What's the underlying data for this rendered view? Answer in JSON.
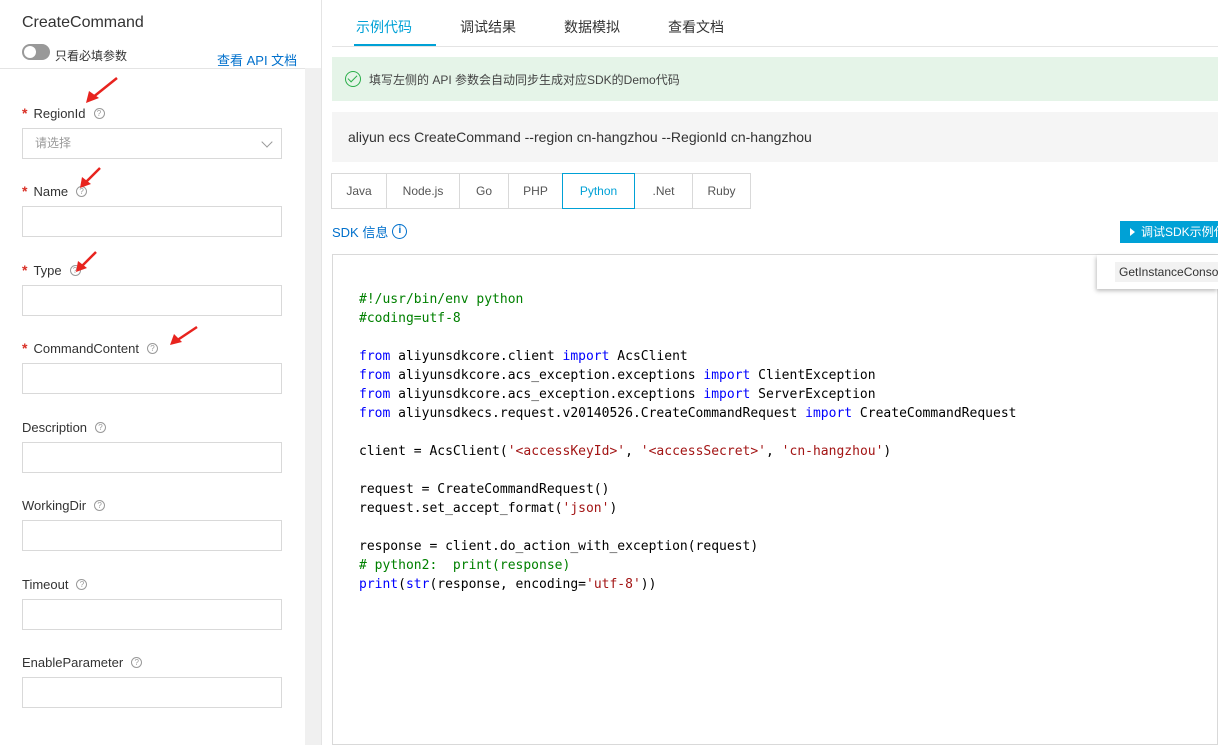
{
  "left": {
    "api_name": "CreateCommand",
    "toggle_label": "只看必填参数",
    "api_doc_link": "查看 API 文档",
    "fields": [
      {
        "label": "RegionId",
        "required": true,
        "type": "select",
        "placeholder": "请选择"
      },
      {
        "label": "Name",
        "required": true,
        "type": "text",
        "value": ""
      },
      {
        "label": "Type",
        "required": true,
        "type": "text",
        "value": ""
      },
      {
        "label": "CommandContent",
        "required": true,
        "type": "text",
        "value": ""
      },
      {
        "label": "Description",
        "required": false,
        "type": "text",
        "value": ""
      },
      {
        "label": "WorkingDir",
        "required": false,
        "type": "text",
        "value": ""
      },
      {
        "label": "Timeout",
        "required": false,
        "type": "text",
        "value": ""
      },
      {
        "label": "EnableParameter",
        "required": false,
        "type": "text",
        "value": ""
      }
    ],
    "required_mark": "*",
    "help_glyph": "?"
  },
  "tabs": [
    {
      "label": "示例代码",
      "active": true
    },
    {
      "label": "调试结果",
      "active": false
    },
    {
      "label": "数据模拟",
      "active": false
    },
    {
      "label": "查看文档",
      "active": false
    }
  ],
  "notice": {
    "text": "填写左侧的 API 参数会自动同步生成对应SDK的Demo代码"
  },
  "cli_command": "aliyun ecs CreateCommand --region cn-hangzhou --RegionId cn-hangzhou",
  "languages": [
    {
      "label": "Java",
      "active": false
    },
    {
      "label": "Node.js",
      "active": false
    },
    {
      "label": "Go",
      "active": false
    },
    {
      "label": "PHP",
      "active": false
    },
    {
      "label": "Python",
      "active": true
    },
    {
      ".label": ".Net",
      "label": ".Net",
      "active": false
    },
    {
      "label": "Ruby",
      "active": false
    }
  ],
  "sdk_info": {
    "label": "SDK 信息",
    "icon": "info-icon"
  },
  "debug_button": {
    "label": "调试SDK示例代码"
  },
  "code_dropdown": {
    "item": "GetInstanceConsoleOutput"
  },
  "colors": {
    "accent": "#00a1d6",
    "link": "#0070cc",
    "required": "#d93026",
    "notice_bg": "#e5f4e8",
    "annotation_arrow": "#e8231e"
  },
  "code_lines": [
    [
      {
        "t": "#!/usr/bin/env python",
        "c": "comment"
      }
    ],
    [
      {
        "t": "#coding=utf-8",
        "c": "comment"
      }
    ],
    [],
    [
      {
        "t": "from",
        "c": "kw"
      },
      {
        "t": " aliyunsdkcore.client ",
        "c": "norm"
      },
      {
        "t": "import",
        "c": "kw"
      },
      {
        "t": " AcsClient",
        "c": "norm"
      }
    ],
    [
      {
        "t": "from",
        "c": "kw"
      },
      {
        "t": " aliyunsdkcore.acs_exception.exceptions ",
        "c": "norm"
      },
      {
        "t": "import",
        "c": "kw"
      },
      {
        "t": " ClientException",
        "c": "norm"
      }
    ],
    [
      {
        "t": "from",
        "c": "kw"
      },
      {
        "t": " aliyunsdkcore.acs_exception.exceptions ",
        "c": "norm"
      },
      {
        "t": "import",
        "c": "kw"
      },
      {
        "t": " ServerException",
        "c": "norm"
      }
    ],
    [
      {
        "t": "from",
        "c": "kw"
      },
      {
        "t": " aliyunsdkecs.request.v20140526.CreateCommandRequest ",
        "c": "norm"
      },
      {
        "t": "import",
        "c": "kw"
      },
      {
        "t": " CreateCommandRequest",
        "c": "norm"
      }
    ],
    [],
    [
      {
        "t": "client = AcsClient(",
        "c": "norm"
      },
      {
        "t": "'<accessKeyId>'",
        "c": "str"
      },
      {
        "t": ", ",
        "c": "norm"
      },
      {
        "t": "'<accessSecret>'",
        "c": "str"
      },
      {
        "t": ", ",
        "c": "norm"
      },
      {
        "t": "'cn-hangzhou'",
        "c": "str"
      },
      {
        "t": ")",
        "c": "norm"
      }
    ],
    [],
    [
      {
        "t": "request = CreateCommandRequest()",
        "c": "norm"
      }
    ],
    [
      {
        "t": "request.set_accept_format(",
        "c": "norm"
      },
      {
        "t": "'json'",
        "c": "str"
      },
      {
        "t": ")",
        "c": "norm"
      }
    ],
    [],
    [
      {
        "t": "response = client.do_action_with_exception(request)",
        "c": "norm"
      }
    ],
    [
      {
        "t": "# python2:  print(response)",
        "c": "comment"
      }
    ],
    [
      {
        "t": "print",
        "c": "kw"
      },
      {
        "t": "(",
        "c": "norm"
      },
      {
        "t": "str",
        "c": "kw"
      },
      {
        "t": "(response, encoding=",
        "c": "norm"
      },
      {
        "t": "'utf-8'",
        "c": "str"
      },
      {
        "t": "))",
        "c": "norm"
      }
    ]
  ]
}
